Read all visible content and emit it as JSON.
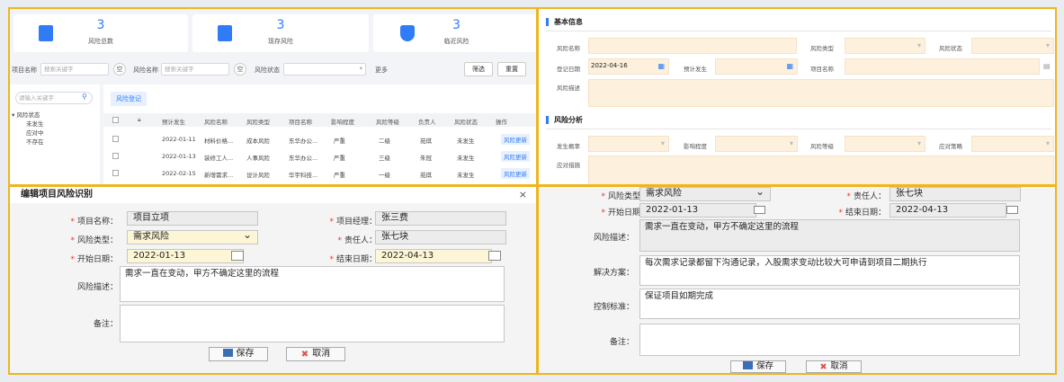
{
  "stats": [
    {
      "value": "3",
      "label": "风险总数",
      "icon": "document-icon"
    },
    {
      "value": "3",
      "label": "现存风险",
      "icon": "document-clock-icon"
    },
    {
      "value": "3",
      "label": "临近风险",
      "icon": "shield-bolt-icon"
    }
  ],
  "filter": {
    "project_label": "项目名称",
    "project_placeholder": "搜索关键字",
    "clear1": "空",
    "risk_label": "风险名称",
    "risk_placeholder": "搜索关键字",
    "clear2": "空",
    "status_label": "风险状态",
    "more": "更多",
    "filter_btn": "筛选",
    "reset_btn": "重置"
  },
  "tree": {
    "search_placeholder": "请输入关键字",
    "root": "风险状态",
    "items": [
      "未发生",
      "应对中",
      "不存在"
    ]
  },
  "grid": {
    "tab": "风险登记",
    "headers": [
      "预计发生",
      "风险名称",
      "风险类型",
      "项目名称",
      "影响程度",
      "风险等级",
      "负责人",
      "风险状态",
      "操作"
    ],
    "rows": [
      [
        "2022-01-11",
        "材料价格...",
        "成本风险",
        "东华办公...",
        "严重",
        "二级",
        "苑琪",
        "未发生",
        "风险更新"
      ],
      [
        "2022-01-13",
        "装修工人...",
        "人事风险",
        "东华办公...",
        "严重",
        "三级",
        "朱冠",
        "未发生",
        "风险更新"
      ],
      [
        "2022-02-15",
        "新增需求...",
        "设计风险",
        "华宇科技...",
        "严重",
        "一级",
        "苑琪",
        "未发生",
        "风险更新"
      ]
    ]
  },
  "basic": {
    "title": "基本信息",
    "risk_name": "风险名称",
    "risk_type": "风险类型",
    "risk_status": "风险状态",
    "reg_date": "登记日期",
    "reg_date_value": "2022-04-16",
    "expected": "预计发生",
    "project": "项目名称",
    "desc": "风险描述"
  },
  "analysis": {
    "title": "风险分析",
    "probability": "发生概率",
    "impact": "影响程度",
    "level": "风险等级",
    "strategy": "应对策略",
    "measures": "应对措施"
  },
  "edit_form": {
    "title": "编辑项目风险识别",
    "close": "⨯",
    "project_name_label": "项目名称：",
    "project_name": "项目立项",
    "manager_label": "项目经理：",
    "manager": "张三费",
    "risk_type_label": "风险类型：",
    "risk_type": "需求风险",
    "owner_label": "责任人：",
    "owner": "张七块",
    "start_label": "开始日期：",
    "start": "2022-01-13",
    "end_label": "结束日期：",
    "end": "2022-04-13",
    "desc_label": "风险描述：",
    "desc": "需求一直在变动，甲方不确定这里的流程",
    "note_label": "备注：",
    "save": "保存",
    "cancel": "取消"
  },
  "edit_form2": {
    "risk_type_label": "风险类型：",
    "risk_type": "需求风险",
    "owner_label": "责任人：",
    "owner": "张七块",
    "start_label": "开始日期：",
    "start": "2022-01-13",
    "end_label": "结束日期：",
    "end": "2022-04-13",
    "desc_label": "风险描述：",
    "desc": "需求一直在变动，甲方不确定这里的流程",
    "solution_label": "解决方案：",
    "solution": "每次需求记录都留下沟通记录，入股需求变动比较大可申请到项目二期执行",
    "control_label": "控制标准：",
    "control": "保证项目如期完成",
    "note_label": "备注：",
    "save": "保存",
    "cancel": "取消"
  },
  "colors": {
    "accent": "#2f7cf6",
    "highlight": "#f0b51e",
    "field": "#fdf0dc"
  }
}
